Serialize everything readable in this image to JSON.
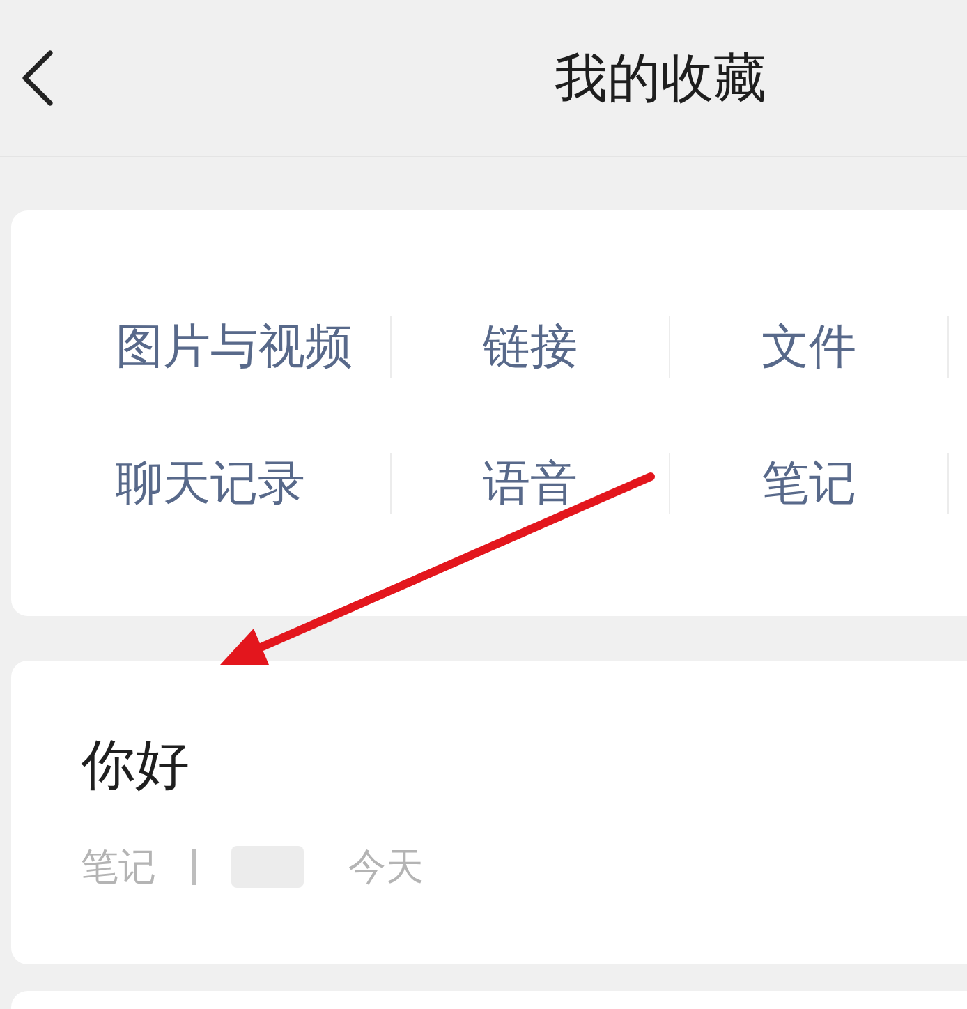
{
  "header": {
    "title": "我的收藏"
  },
  "categories": [
    {
      "label": "图片与视频"
    },
    {
      "label": "链接"
    },
    {
      "label": "文件"
    },
    {
      "label": "聊天记录"
    },
    {
      "label": "语音"
    },
    {
      "label": "笔记"
    }
  ],
  "favorites": [
    {
      "title": "你好",
      "type": "笔记",
      "date": "今天"
    }
  ]
}
